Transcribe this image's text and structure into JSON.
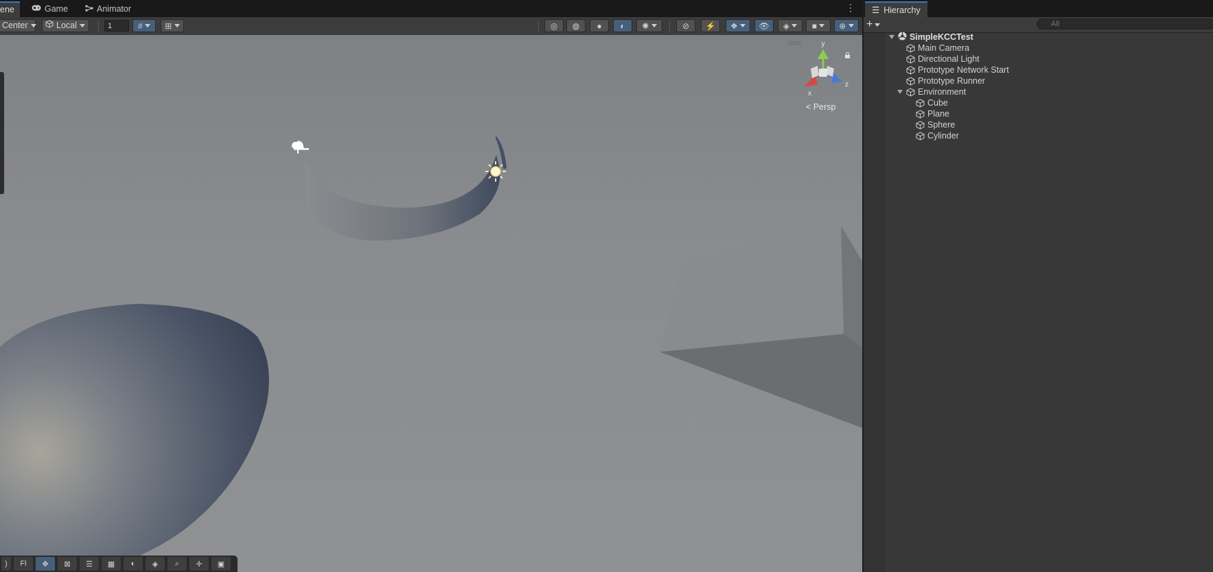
{
  "scene_tabs": {
    "scene": "ene",
    "game": "Game",
    "animator": "Animator"
  },
  "toolbar": {
    "pivot": "Center",
    "space": "Local",
    "grid_value": "1"
  },
  "viewport": {
    "projection": "Persp",
    "gizmo_axes": {
      "y": "y",
      "x": "x",
      "z": "z"
    }
  },
  "bottom_toolbar": {
    "fl_label": "Fl"
  },
  "hierarchy": {
    "tab_title": "Hierarchy",
    "search_placeholder": "All",
    "scene_name": "SimpleKCCTest",
    "items": [
      {
        "label": "Main Camera"
      },
      {
        "label": "Directional Light"
      },
      {
        "label": "Prototype Network Start"
      },
      {
        "label": "Prototype Runner"
      },
      {
        "label": "Environment"
      },
      {
        "label": "Cube"
      },
      {
        "label": "Plane"
      },
      {
        "label": "Sphere"
      },
      {
        "label": "Cylinder"
      }
    ]
  },
  "colors": {
    "accent": "#3a79bb",
    "toggle_on": "#46607c",
    "panel": "#383838",
    "viewport_bg": "#8a8c8f"
  }
}
